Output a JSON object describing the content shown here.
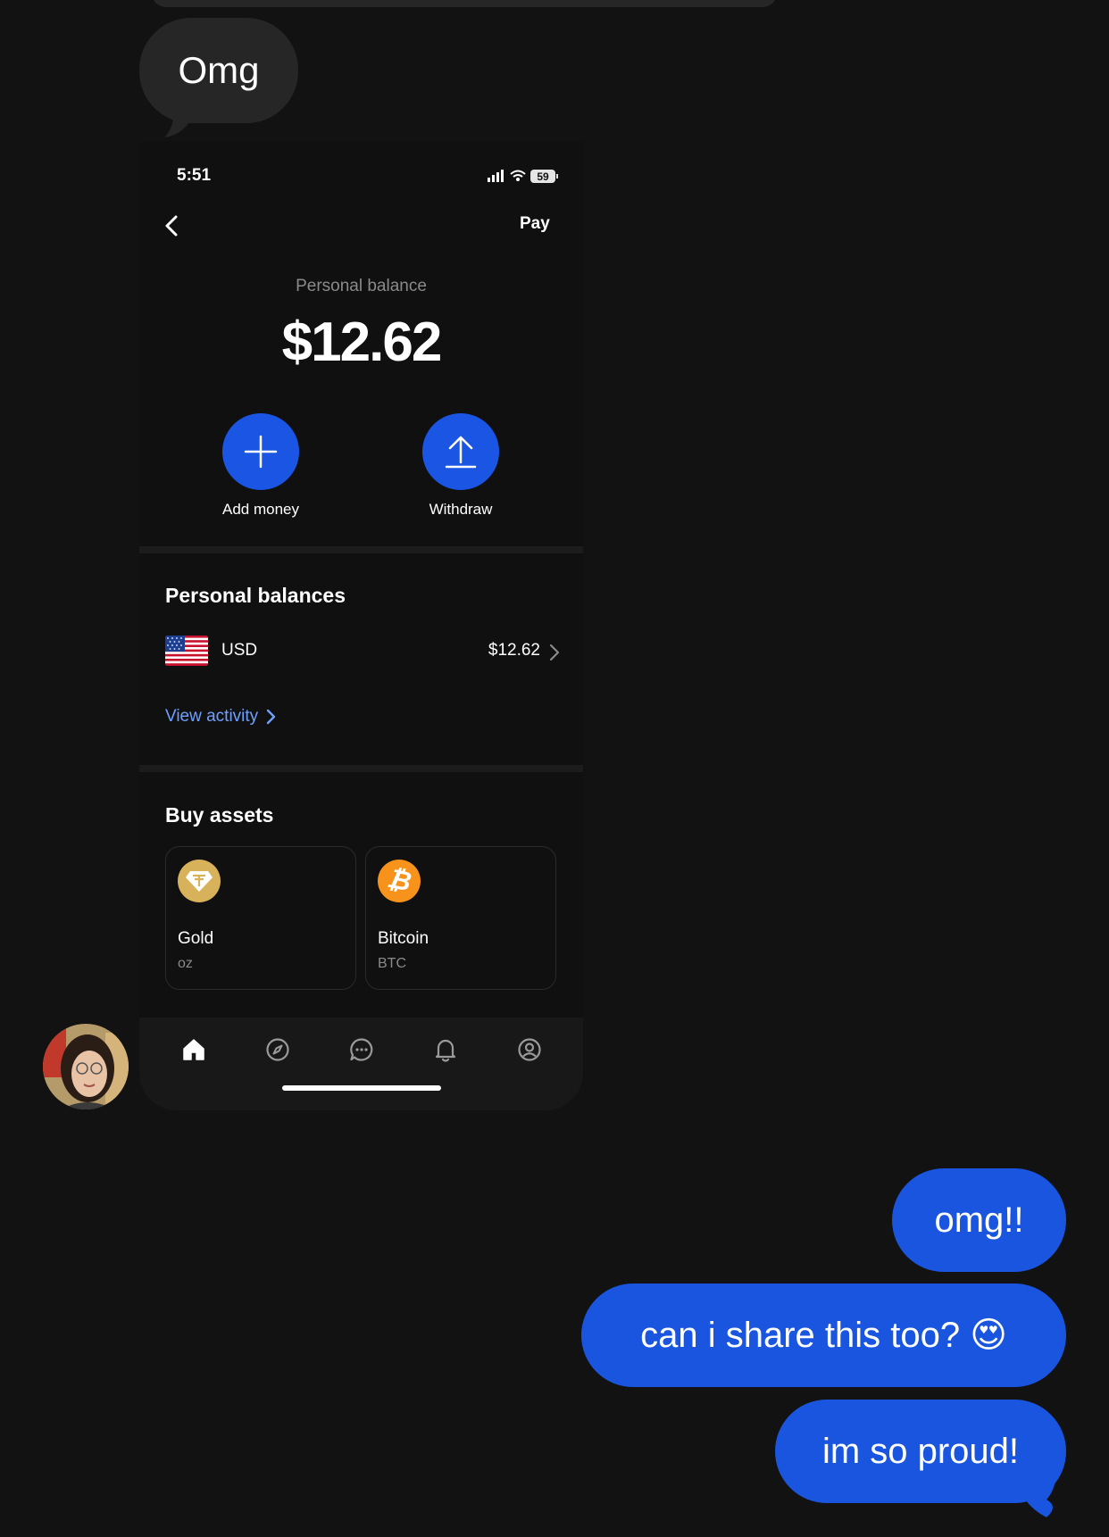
{
  "conversation": {
    "incoming": {
      "text": "Omg"
    },
    "outgoing": [
      {
        "text": "omg!!"
      },
      {
        "text": "can i share this too? 😍"
      },
      {
        "text": "im so proud!"
      }
    ]
  },
  "screenshot": {
    "status_bar": {
      "time": "5:51",
      "battery": "59"
    },
    "header": {
      "right_label": "Pay"
    },
    "balance": {
      "label": "Personal balance",
      "amount": "$12.62"
    },
    "actions": [
      {
        "label": "Add money",
        "icon": "plus-icon"
      },
      {
        "label": "Withdraw",
        "icon": "upload-arrow-icon"
      }
    ],
    "personal_balances": {
      "title": "Personal balances",
      "rows": [
        {
          "currency": "USD",
          "value": "$12.62",
          "icon": "us-flag-icon"
        }
      ],
      "view_activity": "View activity"
    },
    "buy_assets": {
      "title": "Buy assets",
      "items": [
        {
          "name": "Gold",
          "unit": "oz",
          "icon": "gold-icon",
          "color": "#d8b25a"
        },
        {
          "name": "Bitcoin",
          "unit": "BTC",
          "icon": "bitcoin-icon",
          "color": "#f7931a"
        }
      ]
    },
    "tabs": [
      "home-icon",
      "compass-icon",
      "chat-icon",
      "bell-icon",
      "profile-icon"
    ]
  },
  "colors": {
    "accent": "#1a55e3",
    "link": "#6ea0ff",
    "background": "#121212",
    "incoming_bubble": "#262626"
  }
}
